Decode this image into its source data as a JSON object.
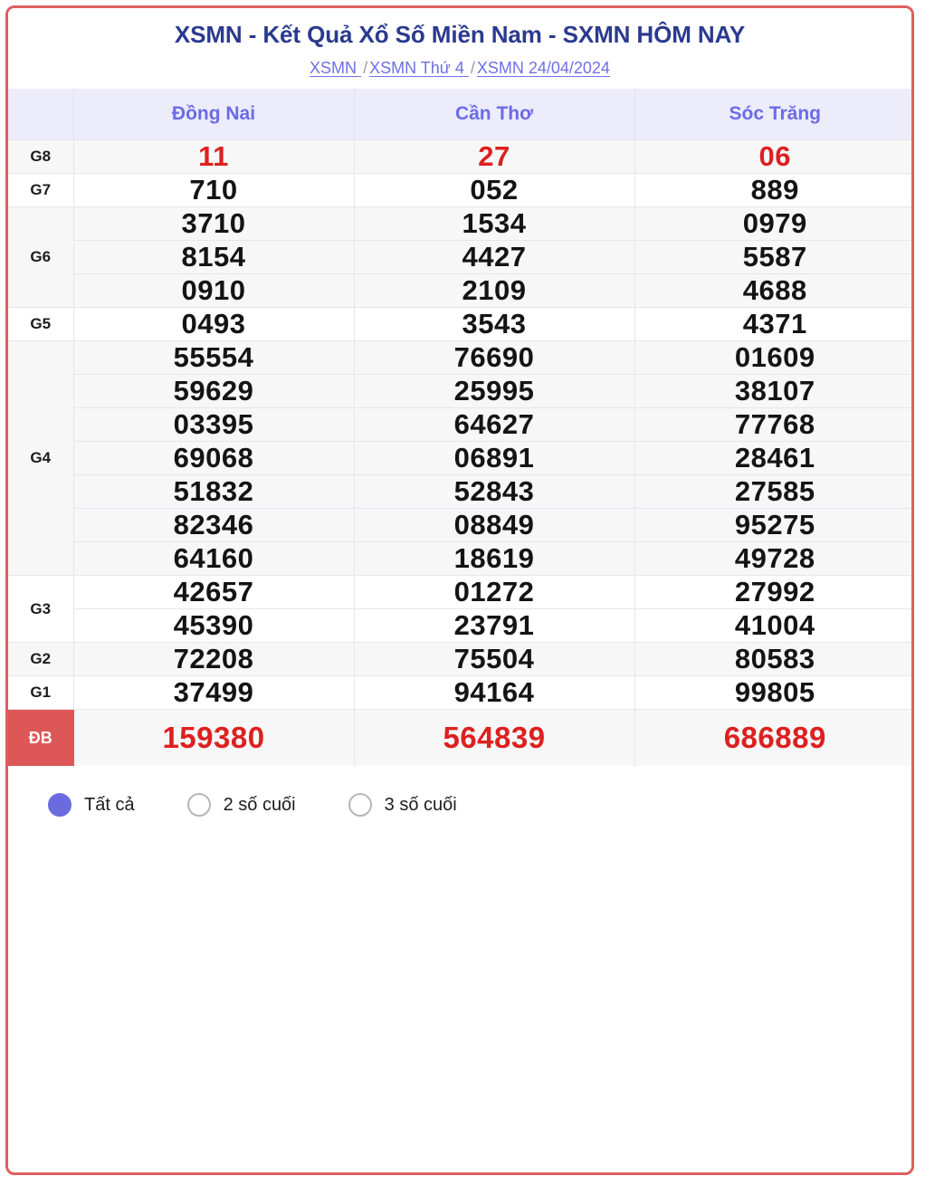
{
  "header": {
    "title": "XSMN - Kết Quả Xổ Số Miền Nam - SXMN HÔM NAY",
    "breadcrumb": [
      {
        "label": "XSMN "
      },
      {
        "label": "XSMN Thứ 4 "
      },
      {
        "label": "XSMN 24/04/2024"
      }
    ],
    "separator": "/"
  },
  "colors": {
    "card_border": "#dd5f5f",
    "title": "#2b3a8f",
    "link": "#6f6fe8",
    "province_header_bg": "#ececfa",
    "province_header_text": "#6b6be8",
    "special_badge_bg": "#dd5757",
    "special_number": "#dd2020",
    "radio_selected": "#6b6be0",
    "row_shade": "#f7f7f7"
  },
  "table": {
    "corner_label": "",
    "provinces": [
      "Đồng Nai",
      "Cần Thơ",
      "Sóc Trăng"
    ],
    "rows": [
      {
        "group": "G8",
        "shade": true,
        "red": true,
        "values": [
          "11",
          "27",
          "06"
        ]
      },
      {
        "group": "G7",
        "shade": false,
        "red": false,
        "values": [
          "710",
          "052",
          "889"
        ]
      },
      {
        "group": "G6",
        "shade": true,
        "red": false,
        "values": [
          "3710",
          "1534",
          "0979"
        ]
      },
      {
        "group": "",
        "shade": true,
        "red": false,
        "values": [
          "8154",
          "4427",
          "5587"
        ],
        "group_for": "G6"
      },
      {
        "group": "",
        "shade": true,
        "red": false,
        "values": [
          "0910",
          "2109",
          "4688"
        ],
        "group_for": "G6"
      },
      {
        "group": "G5",
        "shade": false,
        "red": false,
        "values": [
          "0493",
          "3543",
          "4371"
        ]
      },
      {
        "group": "G4",
        "shade": true,
        "red": false,
        "values": [
          "55554",
          "76690",
          "01609"
        ]
      },
      {
        "group": "",
        "shade": true,
        "red": false,
        "values": [
          "59629",
          "25995",
          "38107"
        ],
        "group_for": "G4"
      },
      {
        "group": "",
        "shade": true,
        "red": false,
        "values": [
          "03395",
          "64627",
          "77768"
        ],
        "group_for": "G4"
      },
      {
        "group": "",
        "shade": true,
        "red": false,
        "values": [
          "69068",
          "06891",
          "28461"
        ],
        "group_for": "G4"
      },
      {
        "group": "",
        "shade": true,
        "red": false,
        "values": [
          "51832",
          "52843",
          "27585"
        ],
        "group_for": "G4"
      },
      {
        "group": "",
        "shade": true,
        "red": false,
        "values": [
          "82346",
          "08849",
          "95275"
        ],
        "group_for": "G4"
      },
      {
        "group": "",
        "shade": true,
        "red": false,
        "values": [
          "64160",
          "18619",
          "49728"
        ],
        "group_for": "G4"
      },
      {
        "group": "G3",
        "shade": false,
        "red": false,
        "values": [
          "42657",
          "01272",
          "27992"
        ]
      },
      {
        "group": "",
        "shade": false,
        "red": false,
        "values": [
          "45390",
          "23791",
          "41004"
        ],
        "group_for": "G3"
      },
      {
        "group": "G2",
        "shade": true,
        "red": false,
        "values": [
          "72208",
          "75504",
          "80583"
        ]
      },
      {
        "group": "G1",
        "shade": false,
        "red": false,
        "values": [
          "37499",
          "94164",
          "99805"
        ]
      },
      {
        "group": "ĐB",
        "shade": true,
        "red": true,
        "values": [
          "159380",
          "564839",
          "686889"
        ],
        "special": true
      }
    ]
  },
  "filters": {
    "options": [
      {
        "label": "Tất cả",
        "selected": true
      },
      {
        "label": "2 số cuối",
        "selected": false
      },
      {
        "label": "3 số cuối",
        "selected": false
      }
    ]
  }
}
